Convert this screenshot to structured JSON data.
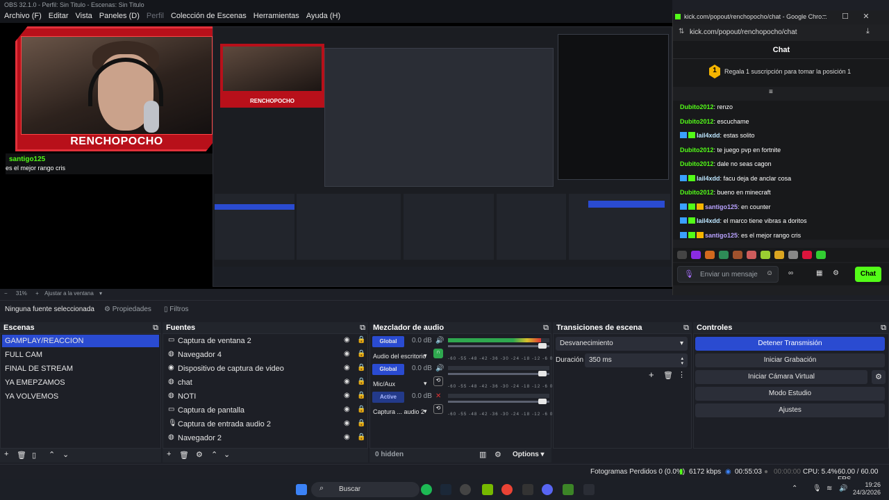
{
  "window_title": "OBS 32.1.0 - Perfil: Sin Titulo - Escenas: Sin Titulo",
  "menu": [
    "Archivo (F)",
    "Editar",
    "Vista",
    "Paneles (D)",
    "Perfil",
    "Colección de Escenas",
    "Herramientas",
    "Ayuda (H)"
  ],
  "preview": {
    "overlay_brand": "RENCHOPOCHO",
    "overlay_chat_user": "santigo125",
    "overlay_chat_msg": "es el mejor rango cris",
    "zoom": "31%",
    "zoom_mode": "Ajustar a la ventana"
  },
  "browser": {
    "title": "kick.com/popout/renchopocho/chat - Google Chro...",
    "url": "kick.com/popout/renchopocho/chat",
    "chat_title": "Chat",
    "goal_badge": "1",
    "goal_text": "Regala 1 suscripción para tomar la posición 1",
    "messages": [
      {
        "user": "Dubito2012",
        "text": "renzo",
        "badges": 0,
        "color": "#53fc18"
      },
      {
        "user": "Dubito2012",
        "text": "escuchame",
        "badges": 0,
        "color": "#53fc18"
      },
      {
        "user": "lail4xdd",
        "text": "estas solito",
        "badges": 2,
        "color": "#bde6ff"
      },
      {
        "user": "Dubito2012",
        "text": "te juego pvp en fortnite",
        "badges": 0,
        "color": "#53fc18"
      },
      {
        "user": "Dubito2012",
        "text": "dale no seas cagon",
        "badges": 0,
        "color": "#53fc18"
      },
      {
        "user": "lail4xdd",
        "text": "facu deja de anclar cosa",
        "badges": 2,
        "color": "#bde6ff"
      },
      {
        "user": "Dubito2012",
        "text": "bueno en minecraft",
        "badges": 0,
        "color": "#53fc18"
      },
      {
        "user": "santigo125",
        "text": "en counter",
        "badges": 3,
        "color": "#b9a3ff"
      },
      {
        "user": "lail4xdd",
        "text": "el marco tiene vibras a doritos",
        "badges": 2,
        "color": "#bde6ff"
      },
      {
        "user": "santigo125",
        "text": "es el mejor rango cris",
        "badges": 3,
        "color": "#b9a3ff"
      }
    ],
    "input_placeholder": "Enviar un mensaje",
    "send_label": "Chat"
  },
  "source_bar": {
    "no_source": "Ninguna fuente seleccionada",
    "properties": "Propiedades",
    "filters": "Filtros"
  },
  "scenes": {
    "title": "Escenas",
    "items": [
      "GAMPLAY/REACCION",
      "FULL CAM",
      "FINAL DE STREAM",
      "YA EMEPZAMOS",
      "YA VOLVEMOS"
    ],
    "selected": "GAMPLAY/REACCION"
  },
  "sources": {
    "title": "Fuentes",
    "items": [
      {
        "name": "Captura de ventana 2",
        "icon": "window-icon"
      },
      {
        "name": "Navegador 4",
        "icon": "globe-icon"
      },
      {
        "name": "Dispositivo de captura de video",
        "icon": "camera-icon"
      },
      {
        "name": "chat",
        "icon": "globe-icon"
      },
      {
        "name": "NOTI",
        "icon": "globe-icon"
      },
      {
        "name": "Captura de pantalla",
        "icon": "monitor-icon"
      },
      {
        "name": "Captura de entrada audio 2",
        "icon": "mic-icon"
      },
      {
        "name": "Navegador 2",
        "icon": "globe-icon"
      }
    ]
  },
  "mixer": {
    "title": "Mezclador de audio",
    "channels": [
      {
        "button": "Global",
        "db": "0.0 dB",
        "name": "Audio del escritorio",
        "level": 0.92
      },
      {
        "button": "Global",
        "db": "0.0 dB",
        "name": "Mic/Aux",
        "level": 0.0
      },
      {
        "button": "Active",
        "db": "0.0 dB",
        "name": "Captura ... audio 2",
        "level": 0.0
      }
    ],
    "scale": "-60 -55 -48 -42 -36 -30 -24 -18 -12 -6 0",
    "hidden": "0 hidden",
    "options": "Options"
  },
  "transitions": {
    "title": "Transiciones de escena",
    "selected": "Desvanecimiento",
    "duration_label": "Duración",
    "duration_value": "350 ms"
  },
  "controls": {
    "title": "Controles",
    "buttons": [
      "Detener Transmisión",
      "Iniciar Grabación",
      "Iniciar Cámara Virtual",
      "Modo Estudio",
      "Ajustes"
    ]
  },
  "status": {
    "dropped": "Fotogramas Perdidos 0 (0.0%)",
    "bitrate": "6172 kbps",
    "stream_time": "00:55:03",
    "rec_time": "00:00:00",
    "cpu": "CPU: 5.4%",
    "fps": "60.00 / 60.00 FPS"
  },
  "taskbar": {
    "search": "Buscar",
    "time": "19:26",
    "date": "24/3/2026"
  },
  "colors": {
    "accent": "#2a4bd1",
    "kick_green": "#53fc18",
    "brand_red": "#b8101a"
  }
}
